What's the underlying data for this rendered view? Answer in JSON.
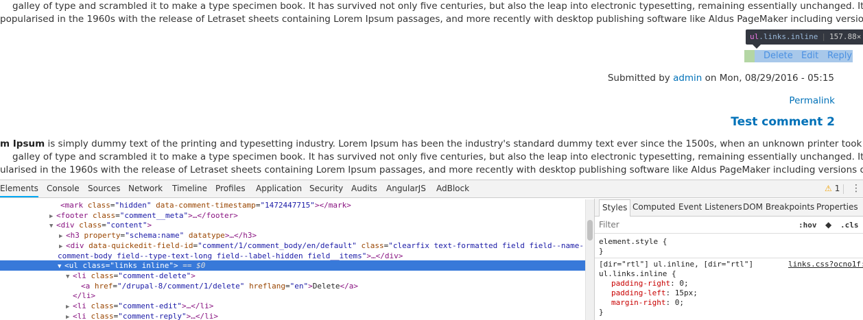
{
  "page": {
    "para1_line1": "galley of type and scrambled it to make a type specimen book. It has survived not only five centuries, but also the leap into electronic typesetting, remaining essentially unchanged. It was",
    "para1_line2": "popularised in the 1960s with the release of Letraset sheets containing Lorem Ipsum passages, and more recently with desktop publishing software like Aldus PageMaker including versions of",
    "tooltip_tag": "ul",
    "tooltip_class": ".links.inline",
    "tooltip_size": "157.88×",
    "links": {
      "delete": "Delete",
      "edit": "Edit",
      "reply": "Reply"
    },
    "submitted_prefix": "Submitted by",
    "submitted_user": "admin",
    "submitted_suffix": "on Mon, 08/29/2016 - 05:15",
    "permalink": "Permalink",
    "comment_title": "Test comment 2",
    "para2_bold": "m Ipsum",
    "para2_line1_rest": " is simply dummy text of the printing and typesetting industry. Lorem Ipsum has been the industry's standard dummy text ever since the 1500s, when an unknown printer took a",
    "para2_line2": "galley of type and scrambled it to make a type specimen book. It has survived not only five centuries, but also the leap into electronic typesetting, remaining essentially unchanged. It was",
    "para2_line3": "ularised in the 1960s with the release of Letraset sheets containing Lorem Ipsum passages, and more recently with desktop publishing software like Aldus PageMaker including versions of"
  },
  "devtools": {
    "tabs": [
      "Elements",
      "Console",
      "Sources",
      "Network",
      "Timeline",
      "Profiles",
      "Application",
      "Security",
      "Audits",
      "AngularJS",
      "AdBlock"
    ],
    "warning_count": "1",
    "tree": [
      {
        "arrow": "",
        "open": "<mark",
        "attrs": [
          [
            "class",
            "\"hidden\""
          ],
          [
            "data-comment-timestamp",
            "\"1472447715\""
          ]
        ],
        "close": "></mark>"
      },
      {
        "arrow": "▶",
        "open": "<footer",
        "attrs": [
          [
            "class",
            "\"comment__meta\""
          ]
        ],
        "close": ">…</footer>"
      },
      {
        "arrow": "▼",
        "open": "<div",
        "attrs": [
          [
            "class",
            "\"content\""
          ]
        ],
        "close": ">"
      },
      {
        "arrow": "▶",
        "open": "<h3",
        "attrs": [
          [
            "property",
            "\"schema:name\""
          ],
          [
            "datatype",
            ""
          ]
        ],
        "close": ">…</h3>"
      },
      {
        "arrow": "▶",
        "open": "<div",
        "attrs": [
          [
            "data-quickedit-field-id",
            "\"comment/1/comment_body/en/default\""
          ],
          [
            "class",
            "\"clearfix text-formatted field field--name-"
          ]
        ],
        "close": ""
      },
      {
        "arrow": "",
        "open": "",
        "attrs": [],
        "close": "comment-body field--type-text-long field--label-hidden field__items\">…</div>"
      },
      {
        "arrow": "▼",
        "open": "<ul",
        "attrs": [
          [
            "class",
            "\"links inline\""
          ]
        ],
        "close": ">",
        "extra": " == $0"
      },
      {
        "arrow": "▼",
        "open": "<li",
        "attrs": [
          [
            "class",
            "\"comment-delete\""
          ]
        ],
        "close": ">"
      },
      {
        "arrow": "",
        "open": "<a",
        "attrs": [
          [
            "href",
            "\"/drupal-8/comment/1/delete\""
          ],
          [
            "hreflang",
            "\"en\""
          ]
        ],
        "close": ">",
        "text": "Delete",
        "end": "</a>"
      },
      {
        "arrow": "",
        "open": "</li>",
        "attrs": [],
        "close": ""
      },
      {
        "arrow": "▶",
        "open": "<li",
        "attrs": [
          [
            "class",
            "\"comment-edit\""
          ]
        ],
        "close": ">…</li>"
      },
      {
        "arrow": "▶",
        "open": "<li",
        "attrs": [
          [
            "class",
            "\"comment-reply\""
          ]
        ],
        "close": ">…</li>"
      }
    ],
    "sidebar_tabs": [
      "Styles",
      "Computed",
      "Event Listeners",
      "DOM Breakpoints",
      "Properties"
    ],
    "filter_placeholder": "Filter",
    "hov": ":hov",
    "cls": ".cls",
    "rule1_selector": "element.style {",
    "rule1_close": "}",
    "rule2_selector_line1": "[dir=\"rtl\"] ul.inline, [dir=\"rtl\"]",
    "rule2_selector_line2": "ul.links.inline {",
    "rule2_source": "links.css?ocno1f:",
    "rule2_props": [
      [
        "padding-right",
        "0;"
      ],
      [
        "padding-left",
        "15px;"
      ],
      [
        "margin-right",
        "0;"
      ]
    ],
    "rule2_close": "}"
  },
  "colors": {
    "link": "#0071b8",
    "selection": "#3879d9",
    "tag": "#881280",
    "attr": "#994500",
    "value": "#1a1aa6"
  }
}
